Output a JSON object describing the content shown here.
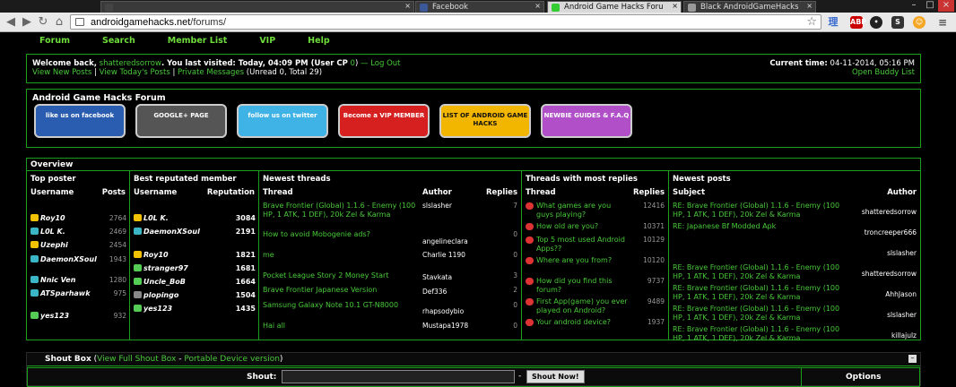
{
  "browser": {
    "tabs": [
      {
        "label": "",
        "active": false
      },
      {
        "label": "Facebook",
        "active": false
      },
      {
        "label": "Android Game Hacks Foru",
        "active": true
      },
      {
        "label": "Black AndroidGameHacks",
        "active": false
      }
    ],
    "url_host": "androidgamehacks.net",
    "url_path": "/forums/",
    "extensions": [
      "理",
      "ABP",
      "•",
      "S",
      "☺",
      "≡"
    ]
  },
  "nav": [
    "Forum",
    "Search",
    "Member List",
    "VIP",
    "Help"
  ],
  "welcome": {
    "prefix": "Welcome back,",
    "user": "shatteredsorrow",
    "last_visit": ". You last visited: Today, 04:09 PM (",
    "user_cp": "User CP",
    "cp_count": "0",
    "logout": "Log Out",
    "links": [
      "View New Posts",
      "View Today's Posts",
      "Private Messages"
    ],
    "pm_status": "(Unread 0, Total 29)",
    "time_label": "Current time:",
    "time_value": "04-11-2014, 05:16 PM",
    "buddy": "Open Buddy List"
  },
  "forum": {
    "title": "Android Game Hacks Forum",
    "banners": [
      {
        "text": "like us on facebook",
        "color": "#2a5db0"
      },
      {
        "text": "GOOGLE+ PAGE",
        "color": "#555555"
      },
      {
        "text": "follow us on twitter",
        "color": "#3fb3e6"
      },
      {
        "text": "Become a VIP MEMBER",
        "color": "#d62020"
      },
      {
        "text": "LIST OF ANDROID GAME HACKS",
        "color": "#f2b500"
      },
      {
        "text": "NEWBIE GUIDES & F.A.Q",
        "color": "#b04fc8"
      }
    ]
  },
  "overview": {
    "title": "Overview",
    "top_poster": {
      "title": "Top poster",
      "col1": "Username",
      "col2": "Posts",
      "rows": [
        {
          "name": "Roy10",
          "val": "2764"
        },
        {
          "name": "L0L K.",
          "val": "2469"
        },
        {
          "name": "Uzephi",
          "val": "2454"
        },
        {
          "name": "DaemonXSoul",
          "val": "1943"
        },
        {
          "name": "Nnic Ven",
          "val": "1280"
        },
        {
          "name": "ATSparhawk",
          "val": "975"
        },
        {
          "name": "yes123",
          "val": "932"
        }
      ]
    },
    "best_rep": {
      "title": "Best reputated member",
      "col1": "Username",
      "col2": "Reputation",
      "rows": [
        {
          "name": "L0L K.",
          "val": "3084"
        },
        {
          "name": "DaemonXSoul",
          "val": "2191"
        },
        {
          "name": "Roy10",
          "val": "1821"
        },
        {
          "name": "stranger97",
          "val": "1681"
        },
        {
          "name": "Uncle_BoB",
          "val": "1664"
        },
        {
          "name": "plopingo",
          "val": "1504"
        },
        {
          "name": "yes123",
          "val": "1435"
        }
      ]
    },
    "newest_threads": {
      "title": "Newest threads",
      "col1": "Thread",
      "col2": "Author",
      "col3": "Replies",
      "rows": [
        {
          "thread": "Brave Frontier (Global) 1.1.6 - Enemy (100 HP, 1 ATK, 1 DEF), 20k Zel & Karma",
          "author": "slslasher",
          "replies": "7"
        },
        {
          "thread": "How to avoid Mobogenie ads?",
          "author": "angelineclara",
          "replies": "0"
        },
        {
          "thread": "me",
          "author": "Charlie 1190",
          "replies": "0"
        },
        {
          "thread": "Pocket League Story 2 Money Start",
          "author": "Stavkata",
          "replies": "3"
        },
        {
          "thread": "Brave Frontier Japanese Version",
          "author": "Def336",
          "replies": "2"
        },
        {
          "thread": "Samsung Galaxy Note 10.1 GT-N8000",
          "author": "rhapsodybio",
          "replies": "0"
        },
        {
          "thread": "Hai all",
          "author": "Mustapa1978",
          "replies": "0"
        }
      ]
    },
    "most_replies": {
      "title": "Threads with most replies",
      "col1": "Thread",
      "col2": "Replies",
      "rows": [
        {
          "thread": "What games are you guys playing?",
          "replies": "12416"
        },
        {
          "thread": "How old are you?",
          "replies": "10371"
        },
        {
          "thread": "Top 5 most used Android Apps??",
          "replies": "10129"
        },
        {
          "thread": "Where are you from?",
          "replies": "10120"
        },
        {
          "thread": "How did you find this forum?",
          "replies": "9737"
        },
        {
          "thread": "First App(game) you ever played on Android?",
          "replies": "9489"
        },
        {
          "thread": "Your android device?",
          "replies": "1937"
        }
      ]
    },
    "newest_posts": {
      "title": "Newest posts",
      "col1": "Subject",
      "col2": "Author",
      "rows": [
        {
          "subject": "RE: Brave Frontier (Global) 1.1.6 - Enemy (100 HP, 1 ATK, 1 DEF), 20k Zel & Karma",
          "author": "shatteredsorrow"
        },
        {
          "subject": "RE: Japanese Bf Modded Apk",
          "author": "troncreeper666"
        },
        {
          "subject": "",
          "author": "slslasher"
        },
        {
          "subject": "RE: Brave Frontier (Global) 1.1.6 - Enemy (100 HP, 1 ATK, 1 DEF), 20k Zel & Karma",
          "author": "shatteredsorrow"
        },
        {
          "subject": "RE: Brave Frontier (Global) 1.1.6 - Enemy (100 HP, 1 ATK, 1 DEF), 20k Zel & Karma",
          "author": "AhhJason"
        },
        {
          "subject": "RE: Brave Frontier (Global) 1.1.6 - Enemy (100 HP, 1 ATK, 1 DEF), 20k Zel & Karma",
          "author": "slslasher"
        },
        {
          "subject": "RE: Brave Frontier (Global) 1.1.6 - Enemy (100 HP, 1 ATK, 1 DEF), 20k Zel & Karma",
          "author": "killajulz"
        }
      ]
    }
  },
  "shoutbox": {
    "title": "Shout Box",
    "full_link": "View Full Shout Box",
    "portable_link": "Portable Device version",
    "shout_label": "Shout:",
    "shout_value": "",
    "dash": "-",
    "button": "Shout Now!",
    "options": "Options",
    "collapse": "–"
  },
  "colors": {
    "accent": "#49c93a",
    "border": "#1c9d1c",
    "bg": "#000000"
  }
}
